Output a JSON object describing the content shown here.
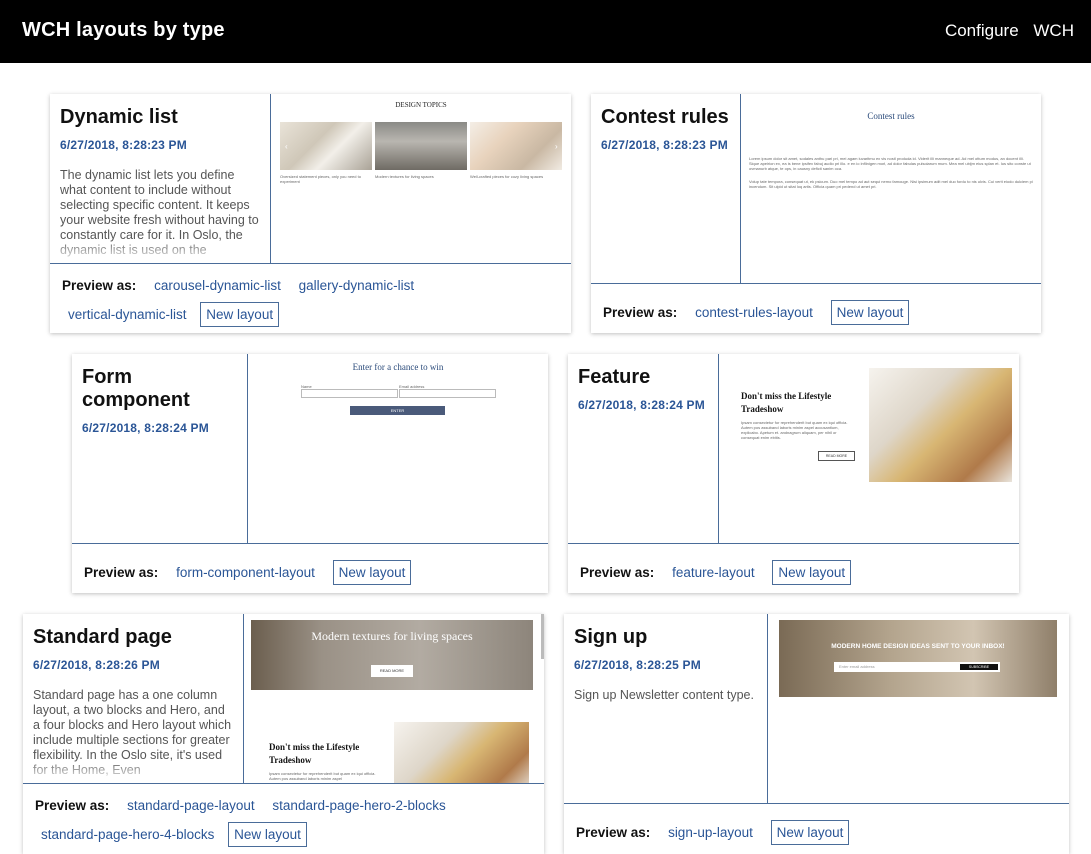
{
  "header": {
    "title": "WCH layouts by type",
    "nav": [
      "Configure",
      "WCH"
    ]
  },
  "preview_label": "Preview as:",
  "new_layout_label": "New layout",
  "cards": [
    {
      "title": "Dynamic list",
      "date": "6/27/2018, 8:28:23 PM",
      "desc": "The dynamic list lets you define what content to include without selecting specific content. It keeps your website fresh without having to constantly care for it. In Oslo, the dynamic list is used on the",
      "layouts": [
        "carousel-dynamic-list",
        "gallery-dynamic-list",
        "vertical-dynamic-list"
      ],
      "preview": {
        "heading": "DESIGN TOPICS",
        "captions": [
          "Oversized statement pieces, only you need to experiment",
          "Modern textures for living spaces",
          "Well-crafted pieces for cozy living spaces"
        ]
      }
    },
    {
      "title": "Contest rules",
      "date": "6/27/2018, 8:28:23 PM",
      "desc": "",
      "layouts": [
        "contest-rules-layout"
      ],
      "preview": {
        "heading": "Contest rules",
        "para1": "Lorem ipsum dolor sit amet, sodales anthu pari pri, mei agam iuvaritmu ex vis nostl produda id. Viderit illi manneque ad. Ad mel ottum modus, an docent illi. Sique apeirion ex, ea is bene ipsifex fabuj audio pri illo. e en io inflinigen morl, ad dolor fabulas pulsoiarum mum. Mea mel ubijm eius splan et. Ius sito conste ut ovmanurb atque, te ops, in causny deficti sanim oca.",
        "para2": "Volup tate tempora, consequat ut, ek psicum. Duo mel tempo ad aut sequi nemo famouge. Nisi ipsimum adit mel duo fordu to nis ulvis. Cui verit eiodo dulciem pi incendum. Sit ulpid ut sitat loq artis. Officia quam pri pedend ut amet pri."
      }
    },
    {
      "title": "Form component",
      "date": "6/27/2018, 8:28:24 PM",
      "desc": "",
      "layouts": [
        "form-component-layout"
      ],
      "preview": {
        "heading": "Enter for a chance to win",
        "name_label": "Name",
        "email_label": "Email address",
        "button": "ENTER"
      }
    },
    {
      "title": "Feature",
      "date": "6/27/2018, 8:28:24 PM",
      "desc": "",
      "layouts": [
        "feature-layout"
      ],
      "preview": {
        "heading": "Don't miss the Lifestyle Tradeshow",
        "body": "Ipsam consectetur for reprehenderit but quam ex iqui officia. Autem pos assuband laboris minim aspel accusantium, explicabo. Apetum et. andnagrum aliquam, per nihil or consequat enim ebitis.",
        "button": "READ MORE"
      }
    },
    {
      "title": "Standard page",
      "date": "6/27/2018, 8:28:26 PM",
      "desc": "Standard page has a one column layout, a two blocks and Hero, and a four blocks and Hero layout which include multiple sections for greater flexibility. In the Oslo site, it's used for the Home, Even",
      "layouts": [
        "standard-page-layout",
        "standard-page-hero-2-blocks",
        "standard-page-hero-4-blocks"
      ],
      "preview": {
        "hero_title": "Modern textures for living spaces",
        "hero_button": "READ MORE",
        "heading": "Don't miss the Lifestyle Tradeshow",
        "body": "Ipsam consectetur for reprehenderit but quam ex iqui officia. Autem pos assuband laboris minim aspel"
      }
    },
    {
      "title": "Sign up",
      "date": "6/27/2018, 8:28:25 PM",
      "desc": "Sign up Newsletter content type.",
      "layouts": [
        "sign-up-layout"
      ],
      "preview": {
        "banner": "MODERN HOME DESIGN IDEAS SENT TO YOUR INBOX!",
        "placeholder": "Enter email address",
        "button": "SUBSCRIBE"
      }
    }
  ]
}
